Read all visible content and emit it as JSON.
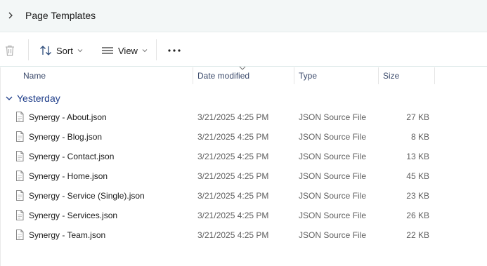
{
  "address": {
    "breadcrumb": "Page Templates"
  },
  "toolbar": {
    "sort_label": "Sort",
    "view_label": "View",
    "more_label": "..."
  },
  "columns": {
    "name": "Name",
    "date": "Date modified",
    "type": "Type",
    "size": "Size"
  },
  "group": {
    "label": "Yesterday"
  },
  "files": [
    {
      "name": "Synergy - About.json",
      "date": "3/21/2025 4:25 PM",
      "type": "JSON Source File",
      "size": "27 KB"
    },
    {
      "name": "Synergy - Blog.json",
      "date": "3/21/2025 4:25 PM",
      "type": "JSON Source File",
      "size": "8 KB"
    },
    {
      "name": "Synergy - Contact.json",
      "date": "3/21/2025 4:25 PM",
      "type": "JSON Source File",
      "size": "13 KB"
    },
    {
      "name": "Synergy - Home.json",
      "date": "3/21/2025 4:25 PM",
      "type": "JSON Source File",
      "size": "45 KB"
    },
    {
      "name": "Synergy - Service (Single).json",
      "date": "3/21/2025 4:25 PM",
      "type": "JSON Source File",
      "size": "23 KB"
    },
    {
      "name": "Synergy - Services.json",
      "date": "3/21/2025 4:25 PM",
      "type": "JSON Source File",
      "size": "26 KB"
    },
    {
      "name": "Synergy - Team.json",
      "date": "3/21/2025 4:25 PM",
      "type": "JSON Source File",
      "size": "22 KB"
    }
  ],
  "icons": {
    "breadcrumb_chevron": "chevron-right-icon",
    "delete": "trash-icon",
    "sort": "sort-arrows-icon",
    "view": "view-list-icon",
    "more": "more-horizontal-icon",
    "group_toggle": "chevron-down-icon",
    "file": "file-icon"
  },
  "colors": {
    "group_accent": "#1f3e8a",
    "header_text": "#3b4a6b",
    "address_bg": "#f3f7f7"
  }
}
